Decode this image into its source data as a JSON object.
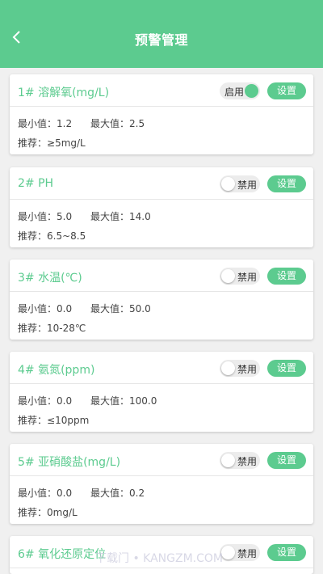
{
  "header": {
    "title": "预警管理"
  },
  "labels": {
    "min": "最小值：",
    "max": "最大值：",
    "recommend": "推荐："
  },
  "colors": {
    "accent": "#5ccb8f",
    "toggle_off": "#ececec",
    "background": "#f0f0f0"
  },
  "cards": [
    {
      "title": "1# 溶解氧(mg/L)",
      "toggle_state": "on",
      "toggle_label": "启用",
      "button_label": "设置",
      "min": "1.2",
      "max": "2.5",
      "recommend": "≥5mg/L"
    },
    {
      "title": "2# PH",
      "toggle_state": "off",
      "toggle_label": "禁用",
      "button_label": "设置",
      "min": "5.0",
      "max": "14.0",
      "recommend": "6.5~8.5"
    },
    {
      "title": "3# 水温(℃)",
      "toggle_state": "off",
      "toggle_label": "禁用",
      "button_label": "设置",
      "min": "0.0",
      "max": "50.0",
      "recommend": "10-28℃"
    },
    {
      "title": "4# 氨氮(ppm)",
      "toggle_state": "off",
      "toggle_label": "禁用",
      "button_label": "设置",
      "min": "0.0",
      "max": "100.0",
      "recommend": "≤10ppm"
    },
    {
      "title": "5# 亚硝酸盐(mg/L)",
      "toggle_state": "off",
      "toggle_label": "禁用",
      "button_label": "设置",
      "min": "0.0",
      "max": "0.2",
      "recommend": "0mg/L"
    },
    {
      "title": "6# 氧化还原定位",
      "toggle_state": "off",
      "toggle_label": "禁用",
      "button_label": "设置"
    }
  ],
  "watermark": "下载门 • KANGZM.COM"
}
